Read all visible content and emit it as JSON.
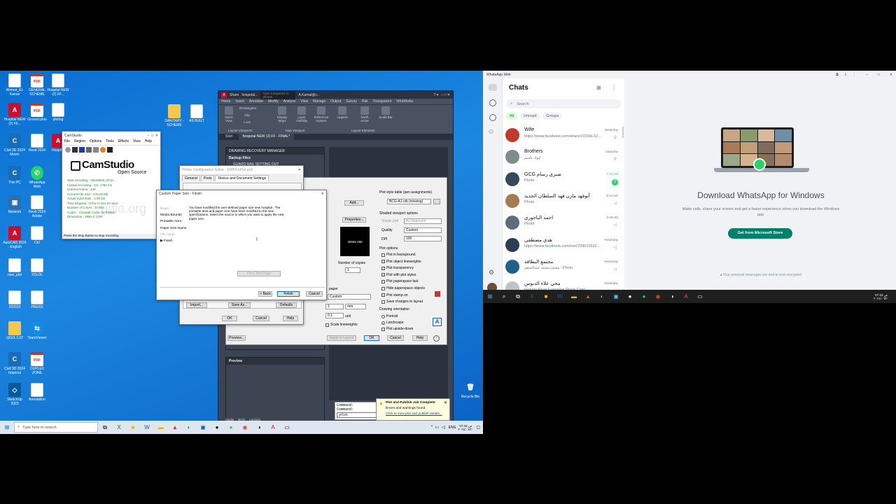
{
  "desktop_icons": [
    {
      "label": "Ahmed_El-Kamal",
      "icon": "doc-icon",
      "kind": "doc"
    },
    {
      "label": "GENERAL SCHEME",
      "icon": "pdf-icon",
      "kind": "pdf"
    },
    {
      "label": "Hospital NEW (2) FF...",
      "icon": "doc-icon",
      "kind": "doc"
    },
    {
      "label": "Hospital NEW (2) FF...",
      "icon": "autocad-icon",
      "kind": "acad"
    },
    {
      "label": "Ground plan",
      "icon": "pdf-icon",
      "kind": "pdf"
    },
    {
      "label": "plotlog",
      "icon": "doc-icon",
      "kind": "doc"
    },
    {
      "label": "SANITARY - SCHEME",
      "icon": "folder-icon",
      "kind": "folder"
    },
    {
      "label": "AS BUILT",
      "icon": "doc-icon",
      "kind": "doc"
    },
    {
      "label": "Civil 3D 2024 Metric",
      "icon": "civil3d-icon",
      "kind": "civil"
    },
    {
      "label": "Revit 2024",
      "icon": "doc-icon",
      "kind": "doc"
    },
    {
      "label": "Hospital",
      "icon": "autocad-icon",
      "kind": "acad"
    },
    {
      "label": "This PC",
      "icon": "computer-icon",
      "kind": "civil"
    },
    {
      "label": "WhatsApp Web",
      "icon": "whatsapp-icon",
      "kind": "wa"
    },
    {
      "label": "Network",
      "icon": "network-icon",
      "kind": "net"
    },
    {
      "label": "Revit 2024 Adobe",
      "icon": "doc-icon",
      "kind": "doc"
    },
    {
      "label": "AutoCAD 2024 - English",
      "icon": "autocad-icon",
      "kind": "acad"
    },
    {
      "label": "Ctrl",
      "icon": "doc-icon",
      "kind": "doc"
    },
    {
      "label": "new_plot",
      "icon": "doc-icon",
      "kind": "doc"
    },
    {
      "label": "XSLOL",
      "icon": "doc-icon",
      "kind": "doc"
    },
    {
      "label": "333333",
      "icon": "doc-icon",
      "kind": "doc"
    },
    {
      "label": "PRESS",
      "icon": "doc-icon",
      "kind": "doc"
    },
    {
      "label": "QGIS 3.22",
      "icon": "folder-icon",
      "kind": "folder"
    },
    {
      "label": "TeamViewer",
      "icon": "teamviewer-icon",
      "kind": "tv"
    },
    {
      "label": "Civil 3D 2024 Imperial",
      "icon": "civil3d-icon",
      "kind": "civil"
    },
    {
      "label": "DUPLEX ZONE",
      "icon": "pdf-icon",
      "kind": "pdf"
    },
    {
      "label": "SketchUp 2023",
      "icon": "sketchup-icon",
      "kind": "sk"
    },
    {
      "label": "Annotation",
      "icon": "doc-icon",
      "kind": "doc"
    },
    {
      "label": "Recycle Bin",
      "icon": "recycle-bin-icon",
      "kind": "bin"
    }
  ],
  "camstudio": {
    "title": "CamStudio",
    "menu": [
      "File",
      "Region",
      "Options",
      "Tools",
      "Effects",
      "View",
      "Help"
    ],
    "logo_main": "CamStudio",
    "logo_sub": "Open Source",
    "stats": [
      "Start recording : 20240620_0742...",
      "Limited recording : On, 1750 ms",
      "Current Frame : 449",
      "Current File Size : 576.00 Mb",
      "Actual Input Rate : 4.05 fps",
      "Time Elapsed : 0 hrs 0 mins 22 secs",
      "Number of Colors : 32 Bits",
      "Codec : Cinepak Codec by Radius",
      "Dimension : 2966 X 1200"
    ],
    "watermark": "udio.org",
    "status": "Press the Stop Button to stop recording"
  },
  "autocad": {
    "search_placeholder": "Type a keyword or phrase",
    "share": "Share",
    "file_short": "hospetal...",
    "user": "A.Kamal@c...",
    "ribbon_tabs": [
      "Home",
      "Insert",
      "Annotate",
      "Modify",
      "Analyze",
      "View",
      "Manage",
      "Output",
      "Survey",
      "Rail",
      "Transparent",
      "InfraWorks"
    ],
    "tools": [
      {
        "label": "Insert View",
        "icon": "insert-view-icon"
      },
      {
        "label": "Rectangular",
        "icon": "rectangle-icon"
      },
      {
        "label": "Clip",
        "icon": "clip-icon"
      },
      {
        "label": "Lock",
        "icon": "lock-icon"
      },
      {
        "label": "Display Maps",
        "icon": "map-icon"
      },
      {
        "label": "Layer Visibility",
        "icon": "layer-icon"
      },
      {
        "label": "Reference System",
        "icon": "reference-icon"
      },
      {
        "label": "Legend",
        "icon": "legend-icon"
      },
      {
        "label": "North Arrow",
        "icon": "north-arrow-icon"
      },
      {
        "label": "Scale Bar",
        "icon": "scale-bar-icon"
      }
    ],
    "ribbon_groups": [
      "Layout Viewports",
      "Map Viewport",
      "Layout Elements"
    ],
    "doc_tabs": [
      "Start",
      "hospetal NEW (2) FF - FINAL*"
    ],
    "recovery_title": "DRAWING RECOVERY MANAGER",
    "backup_title": "Backup Files",
    "backup_item": "GUARD RAIL SETTING OUT",
    "preview_title": "Preview",
    "commands": [
      "Command:",
      "Command:"
    ],
    "command_input": "_plot",
    "layout_tabs": [
      "Model",
      "BOQ",
      "Layout1"
    ]
  },
  "plot_dialog": {
    "add_button": "Add...",
    "properties_button": "Properties...",
    "preview_text": "40655 MM",
    "number_of_copies_label": "Number of copies",
    "copies": "1",
    "paper_label": "paper",
    "custom": "Custom",
    "scale_value": "1",
    "scale_unit": "mm",
    "scale_value2": "0.1",
    "unit": "unit",
    "scale_lineweights": "Scale lineweights",
    "preview_button": "Preview...",
    "apply_button": "Apply to Layout",
    "ok_button": "OK",
    "cancel_button": "Cancel",
    "help_button": "Help",
    "plot_style_title": "Plot style table (pen assignments)",
    "plot_style_value": "BCG-A1.ctb (missing)",
    "shaded_title": "Shaded viewport options",
    "shade_plot_label": "Shade plot",
    "shade_plot_value": "As displayed",
    "quality_label": "Quality",
    "quality_value": "Custom",
    "dpi_label": "DPI",
    "dpi_value": "100",
    "plot_options_title": "Plot options",
    "options": [
      {
        "label": "Plot in background",
        "checked": false
      },
      {
        "label": "Plot object lineweights",
        "checked": false
      },
      {
        "label": "Plot transparency",
        "checked": true
      },
      {
        "label": "Plot with plot styles",
        "checked": true
      },
      {
        "label": "Plot paperspace last",
        "checked": false
      },
      {
        "label": "Hide paperspace objects",
        "checked": false
      },
      {
        "label": "Plot stamp on",
        "checked": true
      },
      {
        "label": "Save changes to layout",
        "checked": false
      }
    ],
    "orientation_title": "Drawing orientation",
    "orientations": [
      {
        "label": "Portrait",
        "selected": false
      },
      {
        "label": "Landscape",
        "selected": true
      },
      {
        "label": "Plot upside-down",
        "selected": false
      }
    ]
  },
  "plotter_editor": {
    "title": "Plotter Configuration Editor - DWF6 ePlot.pc3",
    "tabs": [
      "General",
      "Ports",
      "Device and Document Settings"
    ],
    "buttons": [
      "Import...",
      "Save As...",
      "Defaults"
    ],
    "bottom_buttons": [
      "OK",
      "Cancel",
      "Help"
    ]
  },
  "custom_paper": {
    "title": "Custom Paper Size - Finish",
    "steps": [
      "Begin",
      "Media Bounds",
      "Printable Area",
      "Paper Size Name",
      "File name",
      "Finish"
    ],
    "active_step": "Finish",
    "message": "You have modified the user-defined paper size new hospital . The printable area and paper size have been modified to the new specifications. Select the source to which you want to apply the new paper size.",
    "print_test": "Print Test Page",
    "back": "< Back",
    "finish": "Finish",
    "cancel": "Cancel"
  },
  "notification": {
    "title": "Plot and Publish Job Complete",
    "line1": "Errors and warnings found",
    "link": "Click to view plot and publish details..."
  },
  "left_taskbar": {
    "search_placeholder": "Type here to search",
    "lang": "ENG",
    "time": "07:43 ص",
    "date": "٢٠٢٤/٠٦/٢٠"
  },
  "whatsapp": {
    "window_title": "WhatsApp Web",
    "title": "Chats",
    "search_placeholder": "Search",
    "filters": [
      "All",
      "Unread",
      "Groups"
    ],
    "chats": [
      {
        "name": "Wife",
        "preview": "https://www.facebook.com/share/r/216kL52...",
        "time": "Yesterday",
        "marker": "pin",
        "avatar": "#c0392b"
      },
      {
        "name": "Brothers",
        "preview": "ابوك ناسم",
        "time": "Saturday",
        "marker": "pin",
        "avatar": "#7f8c8d"
      },
      {
        "name": "GCG صبري رسام",
        "preview": "Photo",
        "time": "7:40 AM",
        "marker": "3",
        "avatar": "#34495e"
      },
      {
        "name": "أبوفهد مازن فهد السلطان الجديد",
        "preview": "Photo",
        "time": "6:14 AM",
        "marker": "mute",
        "avatar": "#a67c52"
      },
      {
        "name": "احمد الباجوري",
        "preview": "Photo",
        "time": "2:48 AM",
        "marker": "mute",
        "avatar": "#5d6d7e"
      },
      {
        "name": "هدي مصطفي",
        "preview": "https://www.facebook.com/reel/793015532...",
        "time": "Yesterday",
        "marker": "mute",
        "avatar": "#2c3e50"
      },
      {
        "name": "مجتمع البطاقة",
        "preview": "محمد محمد عبدالمنعم : Photo",
        "time": "Yesterday",
        "marker": "mute",
        "avatar": "#1f618d"
      },
      {
        "name": "محي علاء الدبوس",
        "preview": "Groups Have Everyone Share Cost",
        "time": "Yesterday",
        "marker": "",
        "avatar": "#bdc3c7"
      }
    ],
    "download_title": "Download WhatsApp for Windows",
    "download_desc": "Make calls, share your screen and get a faster experience when you download the Windows app.",
    "download_button": "Get from Microsoft Store",
    "encrypted": "Your personal messages are end-to-end encrypted"
  },
  "right_taskbar": {
    "time": "07:43 ص",
    "date": "٢٠٢٤/٠٦/٢٠"
  },
  "colors": {
    "desktop": "#1c87e0",
    "whatsapp_green": "#008069",
    "autocad_dark": "#3b4453"
  }
}
